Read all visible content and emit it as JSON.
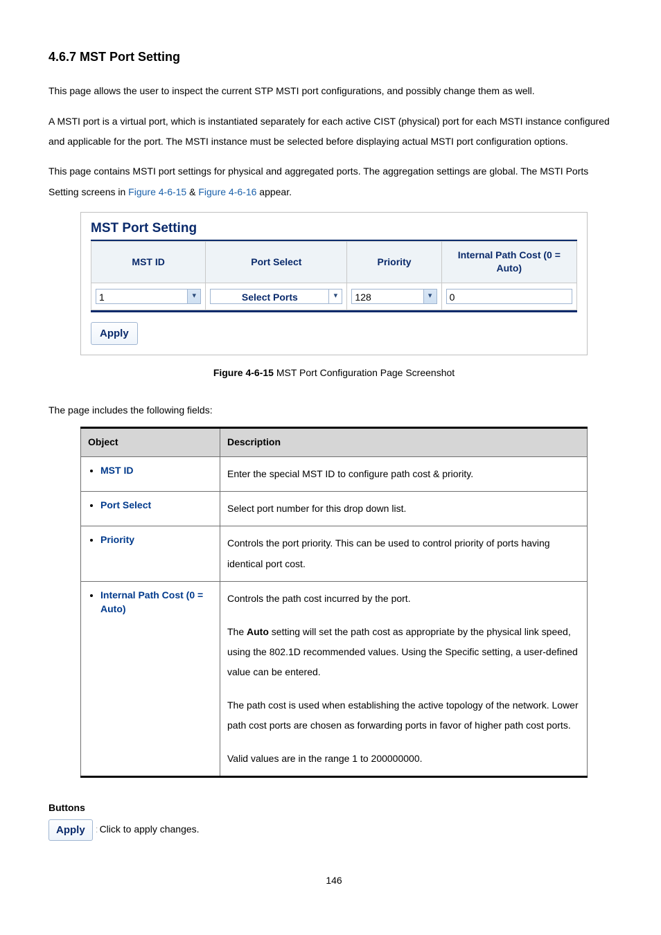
{
  "heading": "4.6.7 MST Port Setting",
  "para1": "This page allows the user to inspect the current STP MSTI port configurations, and possibly change them as well.",
  "para2": "A MSTI port is a virtual port, which is instantiated separately for each active CIST (physical) port for each MSTI instance configured and applicable for the port. The MSTI instance must be selected before displaying actual MSTI port configuration options.",
  "para3_a": "This page contains MSTI port settings for physical and aggregated ports. The aggregation settings are global. The MSTI Ports Setting screens in ",
  "para3_link1": "Figure 4-6-15",
  "para3_amp": " & ",
  "para3_link2": "Figure 4-6-16",
  "para3_b": " appear.",
  "screenshot": {
    "title": "MST Port Setting",
    "headers": {
      "mst_id": "MST ID",
      "port_select": "Port Select",
      "priority": "Priority",
      "ipc": "Internal Path Cost (0 = Auto)"
    },
    "values": {
      "mst_id": "1",
      "port_select": "Select Ports",
      "priority": "128",
      "ipc": "0"
    },
    "apply": "Apply"
  },
  "figure_caption_bold": "Figure 4-6-15",
  "figure_caption_rest": " MST Port Configuration Page Screenshot",
  "fields_intro": "The page includes the following fields:",
  "table": {
    "head_object": "Object",
    "head_description": "Description",
    "rows": [
      {
        "object": "MST ID",
        "desc": "Enter the special MST ID to configure path cost & priority."
      },
      {
        "object": "Port Select",
        "desc": "Select port number for this drop down list."
      },
      {
        "object": "Priority",
        "desc": "Controls the port priority. This can be used to control priority of ports having identical port cost."
      }
    ],
    "row4": {
      "object": "Internal Path Cost (0 = Auto)",
      "l1": "Controls the path cost incurred by the port.",
      "l2a": "The ",
      "l2b": "Auto",
      "l2c": " setting will set the path cost as appropriate by the physical link speed, using the 802.1D recommended values. Using the Specific setting, a user-defined value can be entered.",
      "l3": "The path cost is used when establishing the active topology of the network. Lower path cost ports are chosen as forwarding ports in favor of higher path cost ports.",
      "l4": "Valid values are in the range 1 to 200000000."
    }
  },
  "buttons_heading": "Buttons",
  "buttons_apply": "Apply",
  "buttons_desc": " Click to apply changes.",
  "page_number": "146"
}
